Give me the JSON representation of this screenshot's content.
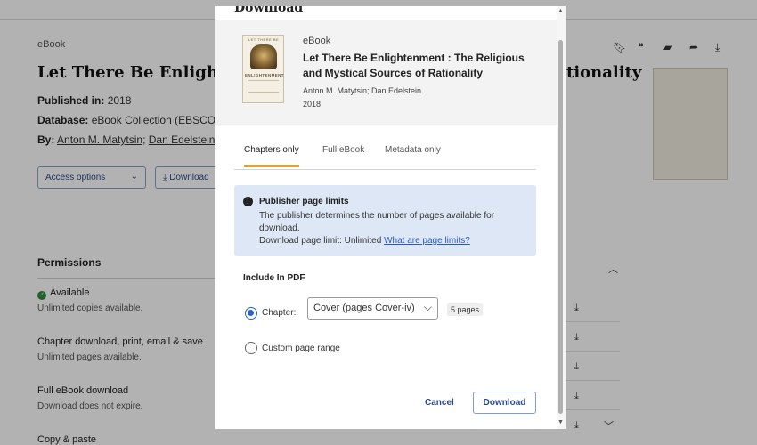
{
  "background": {
    "type_label": "eBook",
    "title": "Let There Be Enlightenment : The Religious and Mystical Sources of Rationality",
    "title_visible_head": "Let There Be Enlightenm",
    "title_visible_tail": "tionality",
    "published_label": "Published in:",
    "published_value": "2018",
    "database_label": "Database:",
    "database_value": "eBook Collection (EBSCOhos",
    "by_label": "By:",
    "author1": "Anton M. Matytsin",
    "author_sep": ";",
    "author2": "Dan Edelstein",
    "access_options": "Access options",
    "download_btn": "Download",
    "permissions_heading": "Permissions",
    "perm1_title": "Available",
    "perm1_sub": "Unlimited copies available.",
    "perm2_title": "Chapter download, print, email & save",
    "perm2_sub": "Unlimited pages available.",
    "perm3_title": "Full eBook download",
    "perm3_sub": "Download does not expire.",
    "perm4_title": "Copy & paste"
  },
  "modal": {
    "top_title": "Download",
    "cover_title": "LET THERE BE",
    "cover_big": "ENLIGHTENMENT",
    "type_label": "eBook",
    "title": "Let There Be Enlightenment : The Religious and Mystical Sources of Rationality",
    "authors": "Anton M. Matytsin; Dan Edelstein",
    "year": "2018",
    "tabs": [
      {
        "label": "Chapters only",
        "active": true
      },
      {
        "label": "Full eBook",
        "active": false
      },
      {
        "label": "Metadata only",
        "active": false
      }
    ],
    "info": {
      "heading": "Publisher page limits",
      "body": "The publisher determines the number of pages available for download.",
      "limit_text": "Download page limit: Unlimited",
      "link": "What are page limits?"
    },
    "include_label": "Include In PDF",
    "chapter_label": "Chapter:",
    "chapter_value": "Cover (pages Cover-iv)",
    "pages_badge": "5 pages",
    "custom_range_label": "Custom page range",
    "cancel": "Cancel",
    "download": "Download"
  }
}
